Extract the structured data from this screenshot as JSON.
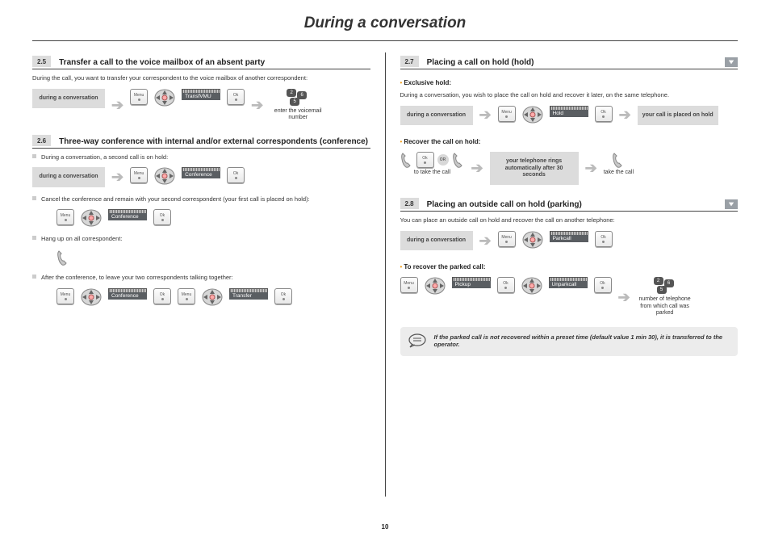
{
  "pageTitle": "During a conversation",
  "pageNumber": "10",
  "left": {
    "s25": {
      "num": "2.5",
      "title": "Transfer a call to the voice mailbox of an absent party",
      "intro": "During the call, you want to transfer your correspondent to the voice mailbox of another correspondent:",
      "row": {
        "convo": "during a conversation",
        "menu": "Menu",
        "screen": "TransfVMU",
        "ok": "Ok",
        "dialCaption": "enter the voicemail number"
      }
    },
    "s26": {
      "num": "2.6",
      "title": "Three-way conference with internal and/or external correspondents (conference)",
      "b1": "During a conversation, a second call is on hold:",
      "row1": {
        "convo": "during a conversation",
        "menu": "Menu",
        "screen": "Conference",
        "ok": "Ok"
      },
      "b2": "Cancel the conference and remain with your second correspondent (your first call is placed on hold):",
      "row2": {
        "menu": "Menu",
        "screen": "Conference",
        "ok": "Ok"
      },
      "b3": "Hang up on all correspondent:",
      "b4": "After the conference, to leave your two correspondents talking together:",
      "row4": {
        "menu": "Menu",
        "screen1": "Conference",
        "ok": "Ok",
        "menu2": "Menu",
        "screen2": "Transfer",
        "ok2": "Ok"
      }
    }
  },
  "right": {
    "s27": {
      "num": "2.7",
      "title": "Placing a call on hold (hold)",
      "sub1": "Exclusive hold:",
      "intro": "During a conversation, you wish to place the call on hold and recover it later, on the same telephone.",
      "row1": {
        "convo": "during a conversation",
        "menu": "Menu",
        "screen": "Hold",
        "ok": "Ok",
        "result": "your call is placed on hold"
      },
      "sub2": "Recover the call on hold:",
      "row2": {
        "ok": "Ok",
        "or": "OR",
        "auto": "your telephone rings automatically after 30 seconds",
        "cap1": "to take the call",
        "cap2": "take the call"
      }
    },
    "s28": {
      "num": "2.8",
      "title": "Placing an outside call on hold (parking)",
      "intro": "You can place an outside call on hold and recover the call on another telephone:",
      "row1": {
        "convo": "during a conversation",
        "menu": "Menu",
        "screen": "Parkcall",
        "ok": "Ok"
      },
      "sub2": "To recover the parked call:",
      "row2": {
        "menu": "Menu",
        "screen1": "Pickup",
        "ok": "Ok",
        "screen2": "Unparkcall",
        "ok2": "Ok",
        "dialCaption": "number of telephone from which call was parked"
      },
      "tip": "If the parked call is not recovered within a preset time (default value 1 min 30), it is transferred to the operator."
    }
  }
}
